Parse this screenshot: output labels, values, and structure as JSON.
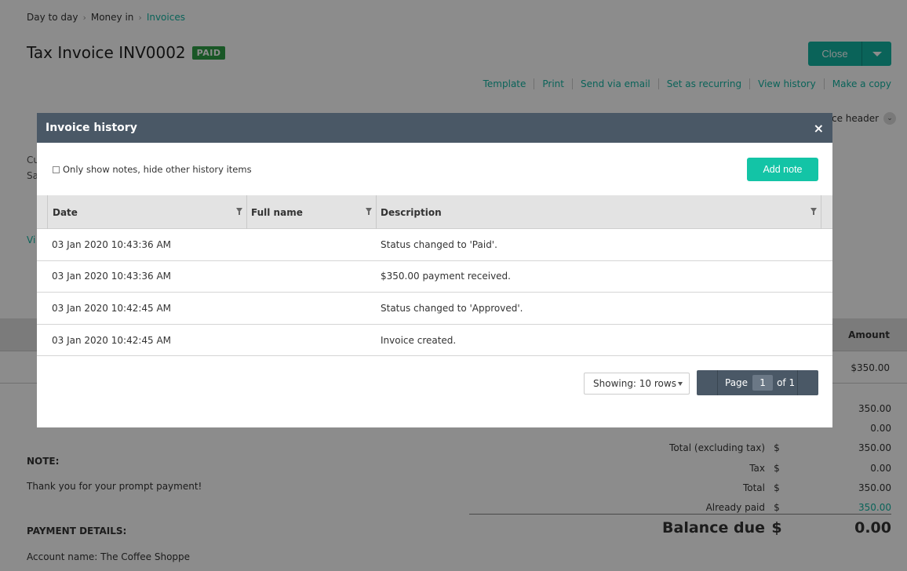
{
  "breadcrumb": {
    "items": [
      "Day to day",
      "Money in"
    ],
    "current": "Invoices"
  },
  "page": {
    "title": "Tax Invoice INV0002",
    "badge": "PAID"
  },
  "close_button": {
    "label": "Close"
  },
  "actions": [
    "Template",
    "Print",
    "Send via email",
    "Set as recurring",
    "View history",
    "Make a copy"
  ],
  "ref_header_fragment": "ce header",
  "stubs": {
    "cu": "Cu",
    "sa": "Sa",
    "vi": "Vi"
  },
  "items_table": {
    "amount_header": "Amount",
    "amount_value": "$350.00"
  },
  "totals": {
    "rows": [
      {
        "label": "",
        "currency": "",
        "value": "350.00"
      },
      {
        "label": "",
        "currency": "",
        "value": "0.00"
      },
      {
        "label": "Total (excluding tax)",
        "currency": "$",
        "value": "350.00"
      },
      {
        "label": "Tax",
        "currency": "$",
        "value": "0.00"
      },
      {
        "label": "Total",
        "currency": "$",
        "value": "350.00"
      },
      {
        "label": "Already paid",
        "currency": "$",
        "value": "350.00"
      }
    ],
    "balance": {
      "label": "Balance due",
      "currency": "$",
      "value": "0.00"
    }
  },
  "note": {
    "title": "NOTE:",
    "text": "Thank you for your prompt payment!"
  },
  "payment": {
    "title": "PAYMENT DETAILS:",
    "account": "Account name: The Coffee Shoppe"
  },
  "modal": {
    "title": "Invoice history",
    "close_glyph": "×",
    "checkbox_label": "Only show notes, hide other history items",
    "add_note_label": "Add note",
    "columns": {
      "date": "Date",
      "name": "Full name",
      "description": "Description"
    },
    "rows": [
      {
        "date": "03 Jan 2020 10:43:36 AM",
        "name": "",
        "description": "Status changed to 'Paid'."
      },
      {
        "date": "03 Jan 2020 10:43:36 AM",
        "name": "",
        "description": "$350.00 payment received."
      },
      {
        "date": "03 Jan 2020 10:42:45 AM",
        "name": "",
        "description": "Status changed to 'Approved'."
      },
      {
        "date": "03 Jan 2020 10:42:45 AM",
        "name": "",
        "description": "Invoice created."
      }
    ],
    "showing_label": "Showing: 10 rows",
    "pager": {
      "page_label": "Page",
      "page_number": "1",
      "of_label": "of 1"
    }
  }
}
